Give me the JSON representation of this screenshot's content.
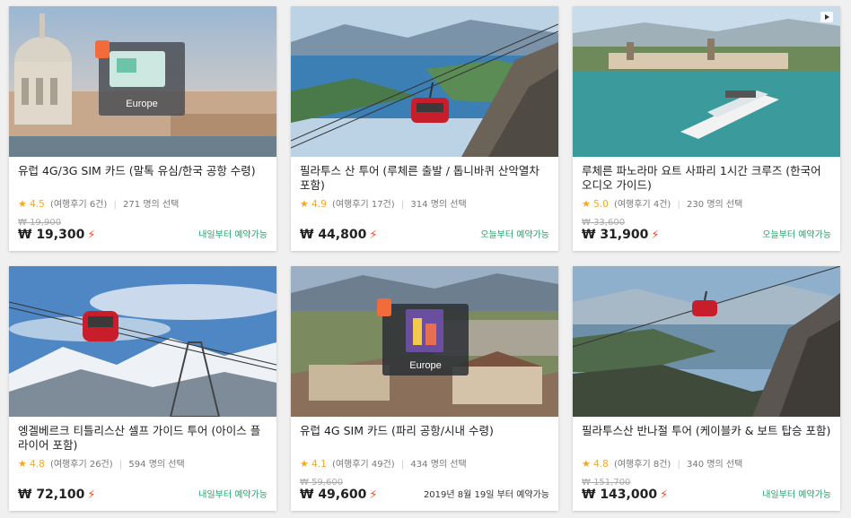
{
  "currency_symbol": "₩",
  "cards": [
    {
      "title": "유럽 4G/3G SIM 카드 (말톡 유심/한국 공항 수령)",
      "rating": "4.5",
      "reviews": "(여행후기 6건)",
      "chosen": "271 명의 선택",
      "original_price": "₩ 19,900",
      "price": "₩ 19,300",
      "availability": "내일부터 예약가능",
      "image_label": "Europe"
    },
    {
      "title": "필라투스 산 투어 (루체른 출발 / 톱니바퀴 산악열차 포함)",
      "rating": "4.9",
      "reviews": "(여행후기 17건)",
      "chosen": "314 명의 선택",
      "original_price": "",
      "price": "₩ 44,800",
      "availability": "오늘부터 예약가능"
    },
    {
      "title": "루체른 파노라마 요트 사파리 1시간 크루즈 (한국어 오디오 가이드)",
      "rating": "5.0",
      "reviews": "(여행후기 4건)",
      "chosen": "230 명의 선택",
      "original_price": "₩ 33,600",
      "price": "₩ 31,900",
      "availability": "오늘부터 예약가능"
    },
    {
      "title": "엥겔베르크 티틀리스산 셀프 가이드 투어 (아이스 플라이어 포함)",
      "rating": "4.8",
      "reviews": "(여행후기 26건)",
      "chosen": "594 명의 선택",
      "original_price": "",
      "price": "₩ 72,100",
      "availability": "내일부터 예약가능"
    },
    {
      "title": "유럽 4G SIM 카드 (파리 공항/시내 수령)",
      "rating": "4.1",
      "reviews": "(여행후기 49건)",
      "chosen": "434 명의 선택",
      "original_price": "₩ 59,600",
      "price": "₩ 49,600",
      "availability": "2019년 8월 19일 부터 예약가능",
      "image_label": "Europe"
    },
    {
      "title": "필라투스산 반나절 투어 (케이블카 & 보트 탑승 포함)",
      "rating": "4.8",
      "reviews": "(여행후기 8건)",
      "chosen": "340 명의 선택",
      "original_price": "₩ 151,700",
      "price": "₩ 143,000",
      "availability": "내일부터 예약가능"
    }
  ],
  "colors": {
    "star": "#f5a623",
    "bolt": "#f24b2a",
    "availability": "#27a36b"
  },
  "icons": [
    "star-icon",
    "lightning-icon",
    "sim-card-icon",
    "video-play-icon"
  ]
}
